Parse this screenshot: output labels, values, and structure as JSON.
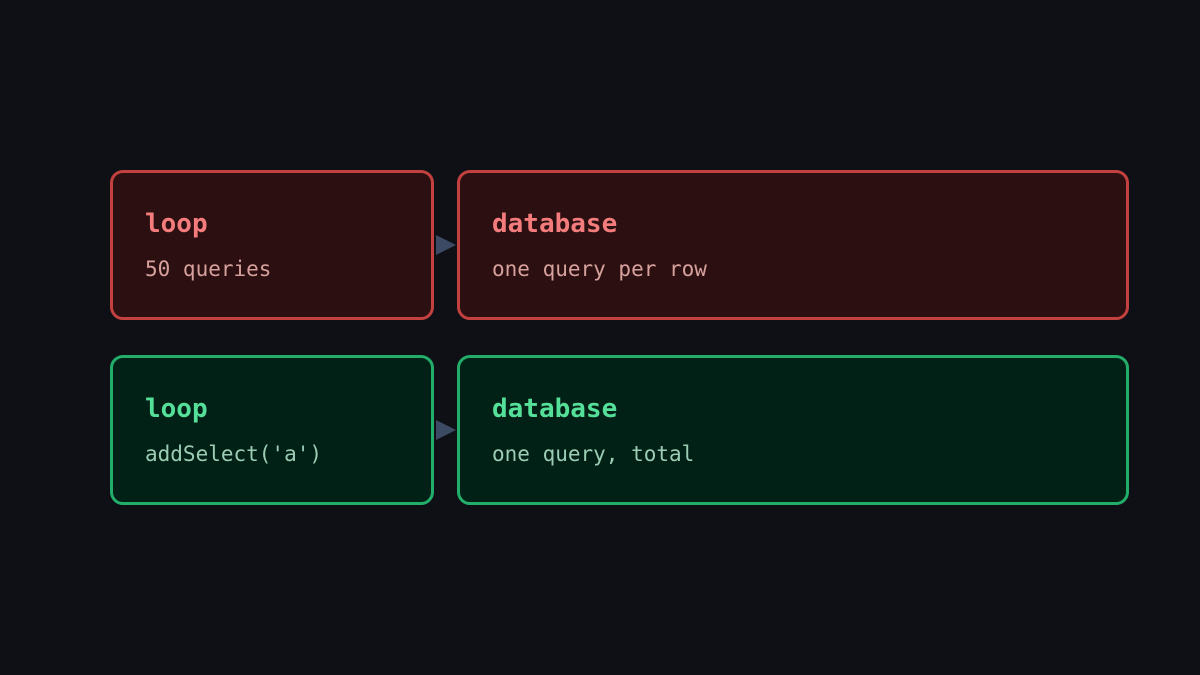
{
  "colors": {
    "background": "#0e1016",
    "bad_border": "#c2413f",
    "bad_fill": "#2c0f10",
    "bad_title": "#f47c7c",
    "good_border": "#22ad6a",
    "good_fill": "#022116",
    "good_title": "#55e09a",
    "arrow": "#3d4a63"
  },
  "rows": [
    {
      "status": "bad",
      "source": {
        "title": "loop",
        "subtitle": "50 queries"
      },
      "target": {
        "title": "database",
        "subtitle": "one query per row"
      },
      "arrow_icon": "arrow-right-icon"
    },
    {
      "status": "good",
      "source": {
        "title": "loop",
        "subtitle": "addSelect('a')"
      },
      "target": {
        "title": "database",
        "subtitle": "one query, total"
      },
      "arrow_icon": "arrow-right-icon"
    }
  ]
}
